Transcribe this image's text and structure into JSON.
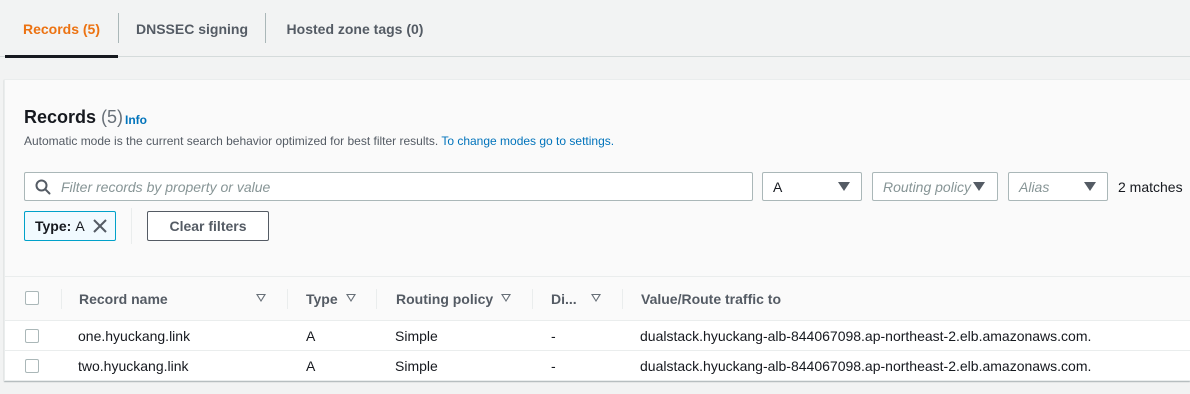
{
  "tabs": [
    {
      "label": "Records (5)",
      "active": true
    },
    {
      "label": "DNSSEC signing",
      "active": false
    },
    {
      "label": "Hosted zone tags (0)",
      "active": false
    }
  ],
  "header": {
    "title": "Records",
    "count": "(5)",
    "info": "Info",
    "description": "Automatic mode is the current search behavior optimized for best filter results.",
    "description_link": "To change modes go to settings."
  },
  "filters": {
    "search_placeholder": "Filter records by property or value",
    "type_value": "A",
    "routing_placeholder": "Routing policy",
    "alias_placeholder": "Alias",
    "matches": "2 matches",
    "token_key": "Type:",
    "token_value": "A",
    "clear_label": "Clear filters"
  },
  "table": {
    "columns": [
      "Record name",
      "Type",
      "Routing policy",
      "Di...",
      "Value/Route traffic to"
    ],
    "rows": [
      {
        "name": "one.hyuckang.link",
        "type": "A",
        "routing": "Simple",
        "di": "-",
        "value": "dualstack.hyuckang-alb-844067098.ap-northeast-2.elb.amazonaws.com."
      },
      {
        "name": "two.hyuckang.link",
        "type": "A",
        "routing": "Simple",
        "di": "-",
        "value": "dualstack.hyuckang-alb-844067098.ap-northeast-2.elb.amazonaws.com."
      }
    ]
  },
  "colors": {
    "accent": "#ec7211",
    "link": "#0073bb",
    "token_border": "#00a1c9"
  }
}
